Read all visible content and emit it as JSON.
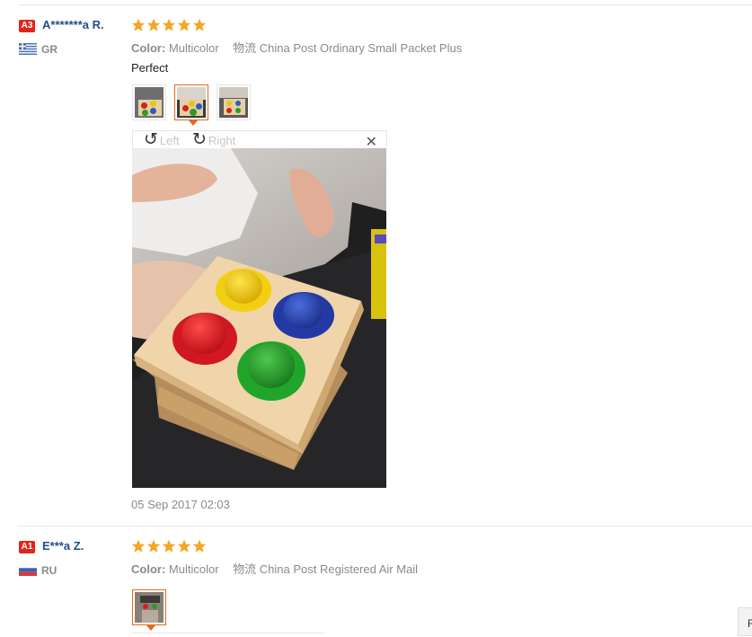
{
  "reviews": [
    {
      "level": "A3",
      "name": "A*******a R.",
      "country": "GR",
      "stars": 5,
      "color_key": "Color:",
      "color_val": "Multicolor",
      "logistics": "物流 China Post Ordinary Small Packet Plus",
      "text": "Perfect",
      "rotate_left": "Left",
      "rotate_right": "Right",
      "date": "05 Sep 2017 02:03"
    },
    {
      "level": "A1",
      "name": "E***a Z.",
      "country": "RU",
      "stars": 5,
      "color_key": "Color:",
      "color_val": "Multicolor",
      "logistics": "物流 China Post Registered Air Mail"
    }
  ],
  "corner_label": "F",
  "colors": {
    "star": "#f5a623",
    "badge": "#e1251b",
    "name": "#1f4e8c",
    "active_thumb": "#e46a1e"
  },
  "icons": {
    "rotate_left": "rotate-left-icon",
    "rotate_right": "rotate-right-icon",
    "close": "close-icon",
    "star": "star-icon"
  }
}
